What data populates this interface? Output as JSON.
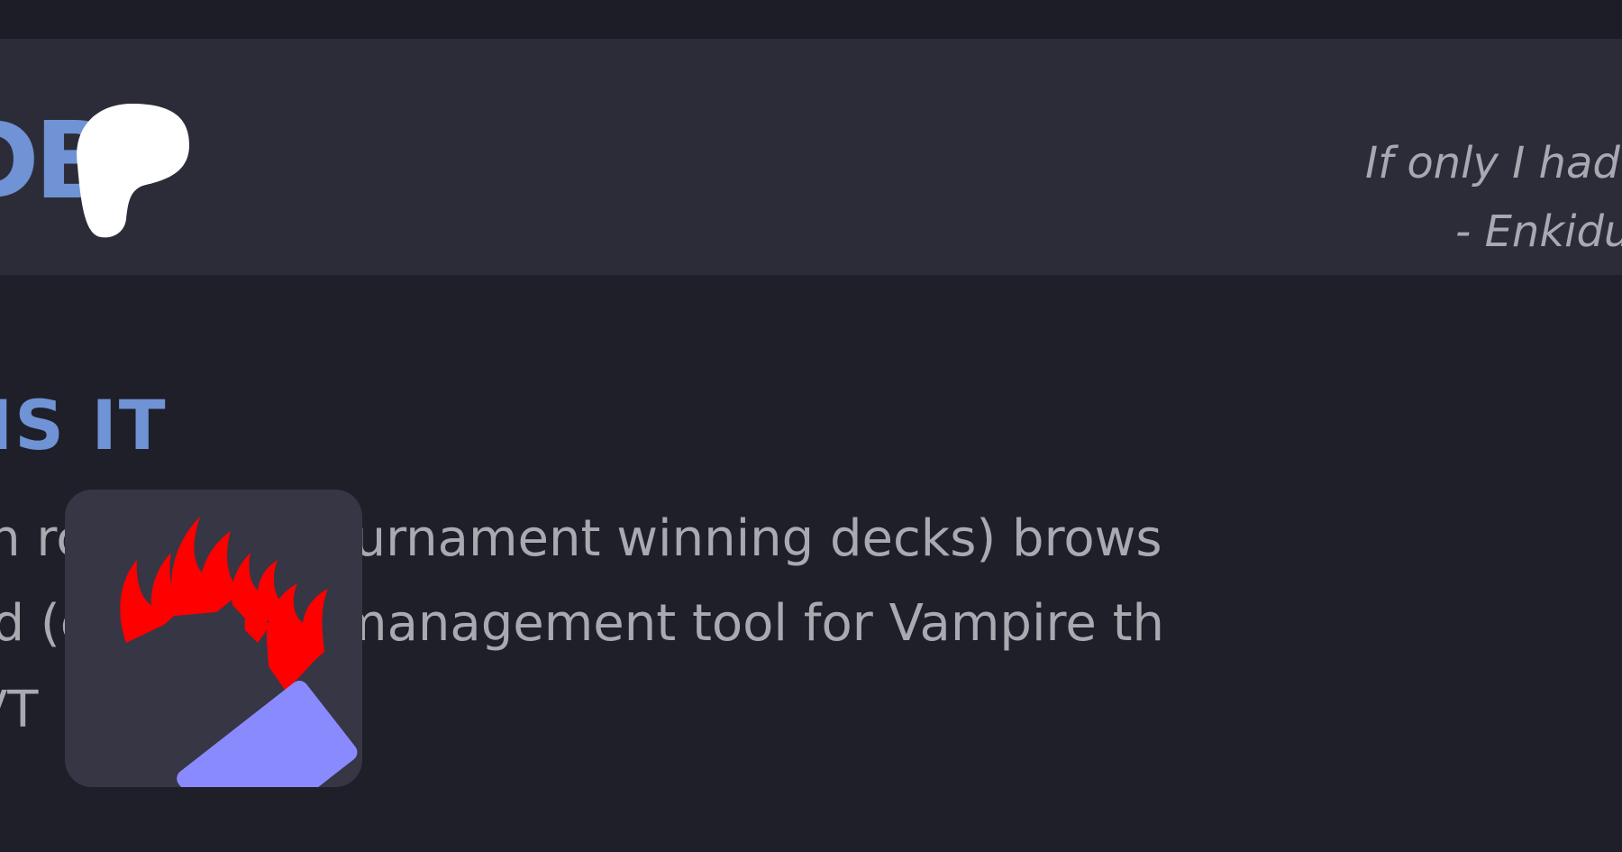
{
  "header": {
    "logo_text": "DB",
    "quote_line1": "If only I had",
    "quote_line2": "- Enkidu"
  },
  "about": {
    "title": "IS IT",
    "line1": "lin          rch, TWD (tournament winning decks) brows",
    "line2": "nd           (collection) management tool for Vampire th",
    "line3": "VT"
  },
  "colors": {
    "background": "#1f1f2a",
    "header_background": "#2c2c39",
    "accent": "#6f93d4",
    "text": "#a9a9b0",
    "icon_background": "#363645",
    "flame": "#ff0000",
    "card": "#8a8aff"
  },
  "icons": {
    "logo_mark": "drop-blob-icon",
    "app_icon": "burning-card-icon"
  }
}
